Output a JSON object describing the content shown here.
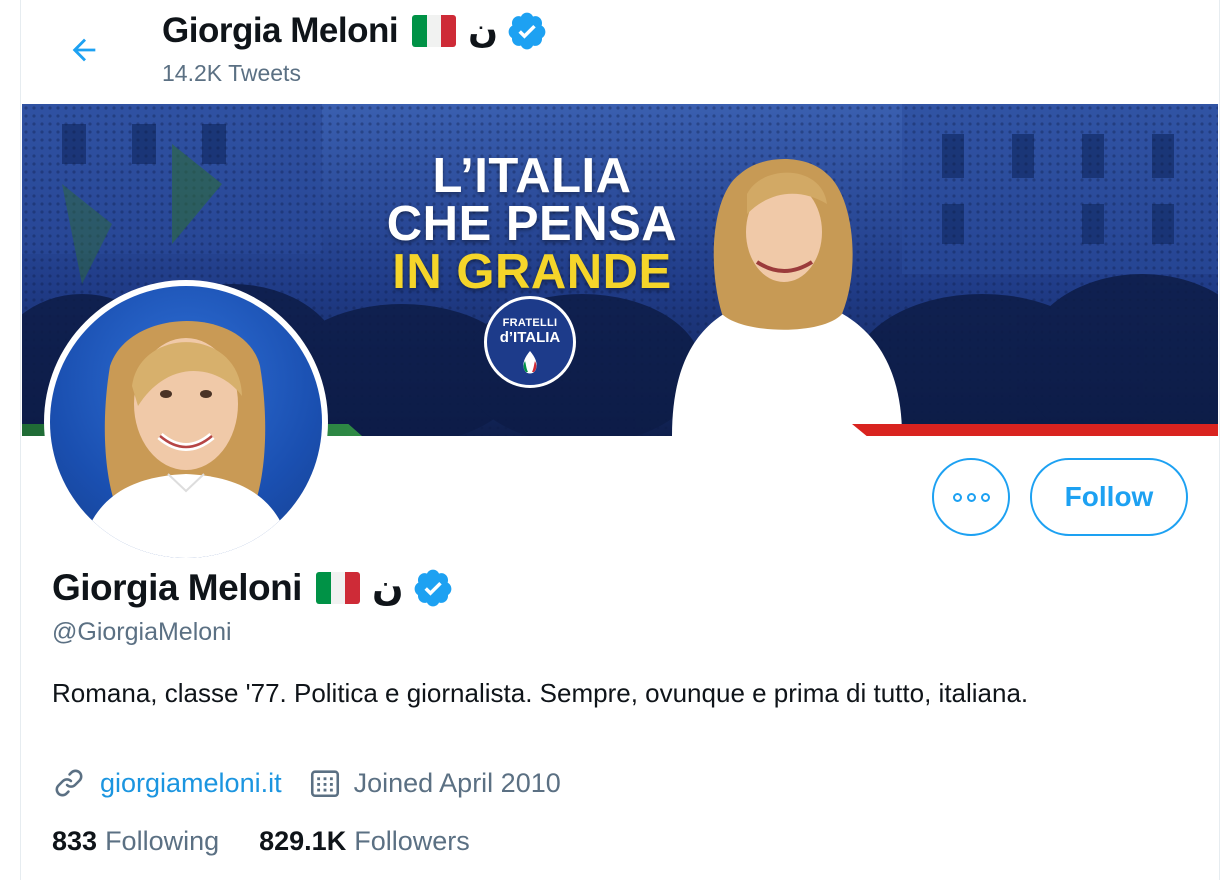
{
  "header": {
    "name": "Giorgia Meloni",
    "emoji_flag": "italy-flag",
    "nun": "ن",
    "tweet_count": "14.2K Tweets"
  },
  "banner": {
    "line1": "L’ITALIA",
    "line2": "CHE PENSA",
    "line3": "IN GRANDE",
    "logo_line1": "FRATELLI",
    "logo_line2": "d’ITALIA"
  },
  "actions": {
    "more_icon": "more-icon",
    "follow_label": "Follow"
  },
  "profile": {
    "name": "Giorgia Meloni",
    "nun": "ن",
    "handle": "@GiorgiaMeloni",
    "bio": "Romana, classe '77. Politica e giornalista. Sempre, ovunque e prima di tutto, italiana.",
    "website": "giorgiameloni.it",
    "joined": "Joined April 2010",
    "following_count": "833",
    "following_label": "Following",
    "followers_count": "829.1K",
    "followers_label": "Followers"
  },
  "colors": {
    "accent": "#1da1f2",
    "verified": "#1da1f2",
    "text_secondary": "#5b7083",
    "flag_green": "#009246",
    "flag_white": "#f1f2f1",
    "flag_red": "#ce2b37",
    "banner_blue": "#1b2c6b",
    "banner_yellow": "#f5d52a"
  }
}
